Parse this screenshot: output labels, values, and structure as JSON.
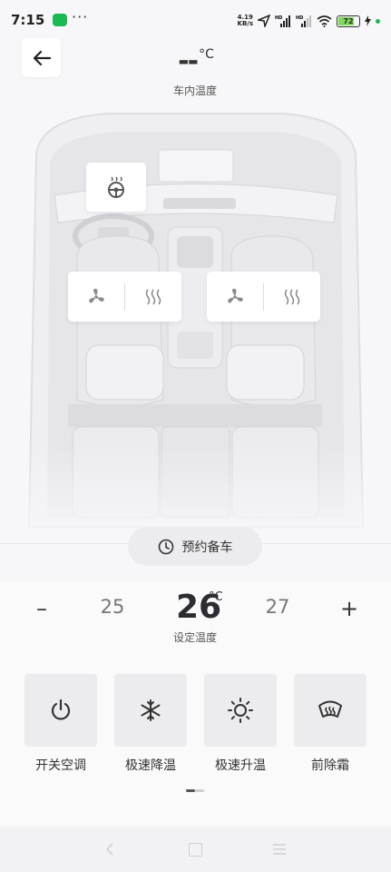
{
  "status_bar": {
    "time": "7:15",
    "net_speed_value": "4.19",
    "net_speed_unit": "KB/s",
    "battery": "72",
    "icons": [
      "wechat-icon",
      "more-dots-icon",
      "location-icon",
      "hd-signal-icon",
      "hd-signal-icon",
      "wifi-icon",
      "battery-icon",
      "charging-icon"
    ]
  },
  "header": {
    "cabin_temp_value": "--",
    "cabin_temp_unit": "°C",
    "cabin_temp_label": "车内温度"
  },
  "reserve_button": {
    "label": "预约备车",
    "icon": "clock-icon"
  },
  "temperature": {
    "minus_label": "–",
    "plus_label": "+",
    "lower": "25",
    "current": "26",
    "higher": "27",
    "unit": "°C",
    "label": "设定温度"
  },
  "functions": [
    {
      "label": "开关空调",
      "icon": "power-icon"
    },
    {
      "label": "极速降温",
      "icon": "snowflake-icon"
    },
    {
      "label": "极速升温",
      "icon": "sun-icon"
    },
    {
      "label": "前除霜",
      "icon": "defrost-icon"
    }
  ],
  "colors": {
    "accent_dark": "#2b2d33",
    "button_bg": "#ececef",
    "icon_gray": "#8a8a8e",
    "battery_green": "#7ed957"
  }
}
